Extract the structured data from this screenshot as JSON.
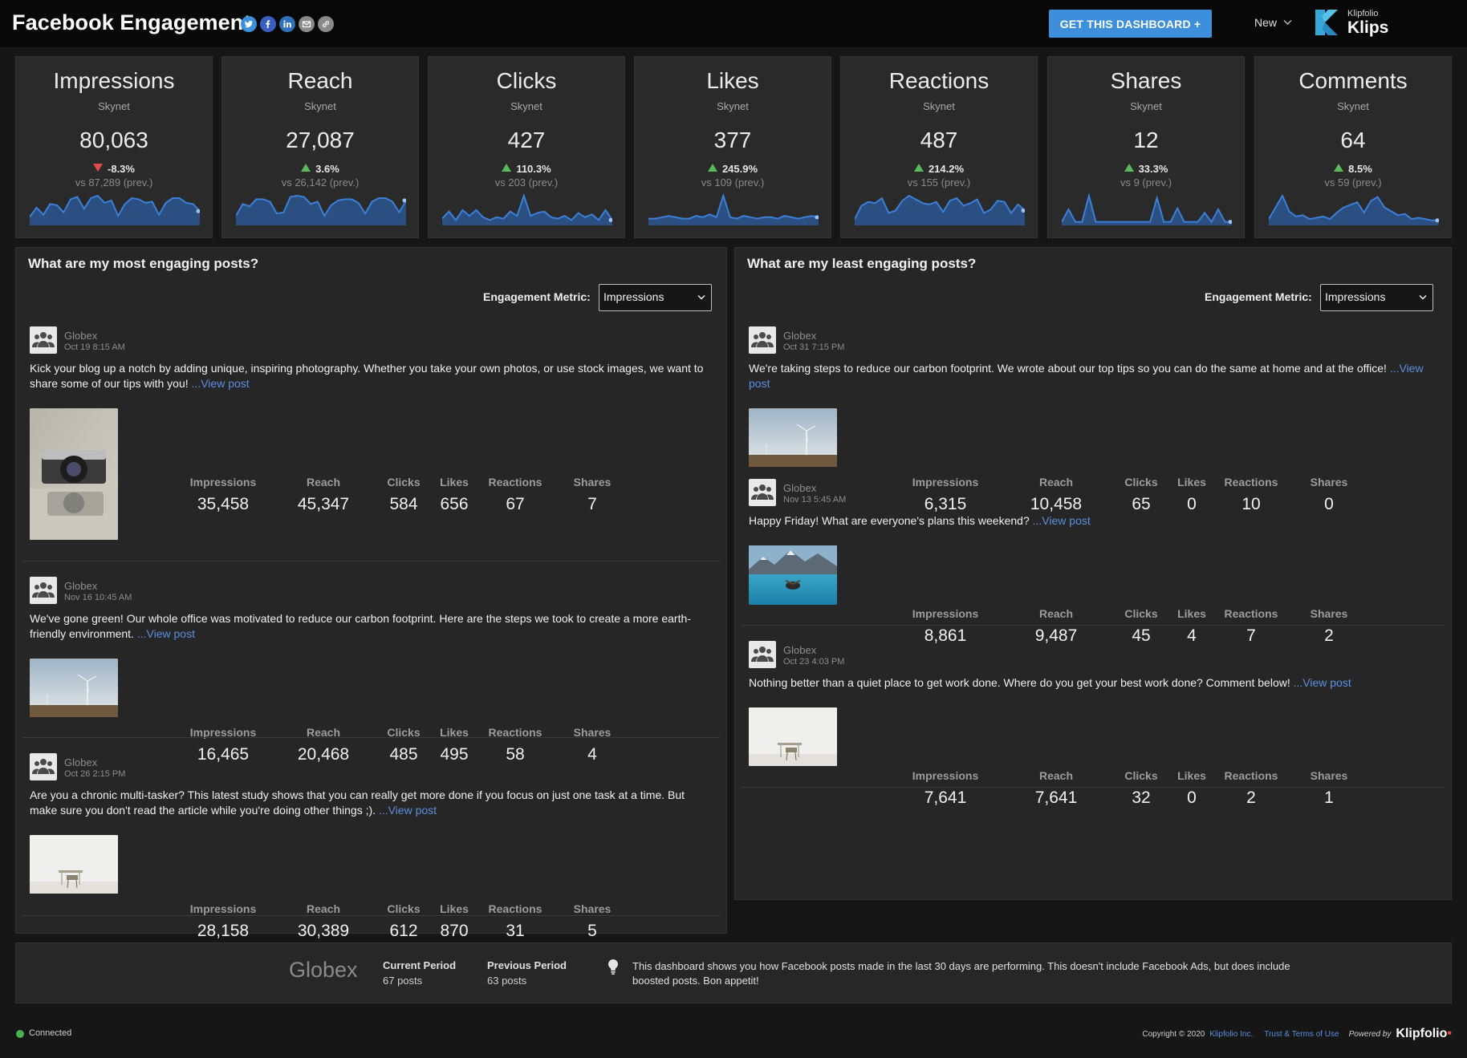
{
  "header": {
    "title": "Facebook Engagement",
    "share_icons": [
      "twitter-icon",
      "facebook-icon",
      "linkedin-icon",
      "email-icon",
      "link-icon"
    ],
    "get_dashboard_label": "GET THIS DASHBOARD +",
    "new_menu_label": "New",
    "brand_small": "Klipfolio",
    "brand_big": "Klips"
  },
  "kpis": [
    {
      "title": "Impressions",
      "source": "Skynet",
      "value": "80,063",
      "direction": "down",
      "change": "-8.3%",
      "prev": "vs 87,289 (prev.)",
      "spark": [
        5,
        13,
        7,
        16,
        15,
        9,
        20,
        22,
        12,
        21,
        23,
        17,
        19,
        6,
        16,
        21,
        20,
        17,
        18,
        7,
        17,
        21,
        21,
        17,
        16,
        10
      ]
    },
    {
      "title": "Reach",
      "source": "Skynet",
      "value": "27,087",
      "direction": "up",
      "change": "3.6%",
      "prev": "vs 26,142 (prev.)",
      "spark": [
        6,
        16,
        14,
        20,
        20,
        18,
        8,
        9,
        22,
        23,
        22,
        16,
        18,
        6,
        15,
        19,
        20,
        20,
        17,
        8,
        18,
        21,
        21,
        18,
        9,
        19
      ]
    },
    {
      "title": "Clicks",
      "source": "Skynet",
      "value": "427",
      "direction": "up",
      "change": "110.3%",
      "prev": "vs 203 (prev.)",
      "spark": [
        3,
        8,
        2,
        9,
        5,
        9,
        4,
        2,
        4,
        3,
        8,
        5,
        19,
        5,
        7,
        8,
        4,
        3,
        5,
        2,
        7,
        4,
        6,
        2,
        9,
        2
      ]
    },
    {
      "title": "Likes",
      "source": "Skynet",
      "value": "377",
      "direction": "up",
      "change": "245.9%",
      "prev": "vs 109 (prev.)",
      "spark": [
        3,
        3,
        4,
        5,
        4,
        3,
        3,
        5,
        4,
        6,
        4,
        19,
        4,
        3,
        5,
        4,
        3,
        4,
        4,
        3,
        5,
        4,
        3,
        4,
        5,
        4
      ]
    },
    {
      "title": "Reactions",
      "source": "Skynet",
      "value": "487",
      "direction": "up",
      "change": "214.2%",
      "prev": "vs 155 (prev.)",
      "spark": [
        3,
        14,
        17,
        16,
        20,
        8,
        10,
        18,
        22,
        19,
        16,
        15,
        17,
        9,
        18,
        20,
        14,
        16,
        19,
        8,
        11,
        18,
        17,
        8,
        15,
        10
      ]
    },
    {
      "title": "Shares",
      "source": "Skynet",
      "value": "12",
      "direction": "up",
      "change": "33.3%",
      "prev": "vs 9 (prev.)",
      "spark": [
        1,
        12,
        1,
        1,
        24,
        1,
        1,
        1,
        1,
        1,
        1,
        1,
        1,
        1,
        22,
        1,
        1,
        13,
        1,
        1,
        1,
        9,
        1,
        12,
        1,
        1
      ]
    },
    {
      "title": "Comments",
      "source": "Skynet",
      "value": "64",
      "direction": "up",
      "change": "8.5%",
      "prev": "vs 59 (prev.)",
      "spark": [
        3,
        12,
        21,
        9,
        5,
        6,
        3,
        4,
        5,
        3,
        8,
        12,
        14,
        16,
        8,
        17,
        20,
        12,
        9,
        6,
        7,
        3,
        4,
        3,
        2,
        2
      ]
    }
  ],
  "most_engaging": {
    "title": "What are my most engaging posts?",
    "metric_label": "Engagement Metric:",
    "metric_value": "Impressions",
    "posts": [
      {
        "author": "Globex",
        "date": "Oct 19 8:15 AM",
        "text": "Kick your blog up a notch by adding unique, inspiring photography. Whether you take your own photos, or use stock images, we want to share some of our tips with you!",
        "link": "...View post",
        "image": "camera-photo",
        "stats": {
          "Impressions": "35,458",
          "Reach": "45,347",
          "Clicks": "584",
          "Likes": "656",
          "Reactions": "67",
          "Shares": "7"
        }
      },
      {
        "author": "Globex",
        "date": "Nov 16 10:45 AM",
        "text": "We've gone green! Our whole office was motivated to reduce our carbon footprint. Here are the steps we took to create a more earth-friendly environment.",
        "link": "...View post",
        "image": "wind-turbine-photo",
        "stats": {
          "Impressions": "16,465",
          "Reach": "20,468",
          "Clicks": "485",
          "Likes": "495",
          "Reactions": "58",
          "Shares": "4"
        }
      },
      {
        "author": "Globex",
        "date": "Oct 26 2:15 PM",
        "text": "Are you a chronic multi-tasker? This latest study shows that you can really get more done if you focus on just one task at a time. But make sure you don't read the article while you're doing other things ;).",
        "link": "...View post",
        "image": "desk-chair-photo",
        "stats": {
          "Impressions": "28,158",
          "Reach": "30,389",
          "Clicks": "612",
          "Likes": "870",
          "Reactions": "31",
          "Shares": "5"
        }
      }
    ]
  },
  "least_engaging": {
    "title": "What are my least engaging posts?",
    "metric_label": "Engagement Metric:",
    "metric_value": "Impressions",
    "posts": [
      {
        "author": "Globex",
        "date": "Oct 31 7:15 PM",
        "text": "We're taking steps to reduce our carbon footprint. We wrote about our top tips so you can do the same at home and at the office!",
        "link": "...View post",
        "image": "wind-turbine-photo",
        "stats": {
          "Impressions": "6,315",
          "Reach": "10,458",
          "Clicks": "65",
          "Likes": "0",
          "Reactions": "10",
          "Shares": "0"
        }
      },
      {
        "author": "Globex",
        "date": "Nov 13 5:45 AM",
        "text": "Happy Friday! What are everyone's plans this weekend?",
        "link": "...View post",
        "image": "mountain-lake-photo",
        "stats": {
          "Impressions": "8,861",
          "Reach": "9,487",
          "Clicks": "45",
          "Likes": "4",
          "Reactions": "7",
          "Shares": "2"
        }
      },
      {
        "author": "Globex",
        "date": "Oct 23 4:03 PM",
        "text": "Nothing better than a quiet place to get work done. Where do you get your best work done? Comment below!",
        "link": "...View post",
        "image": "desk-chair-photo",
        "stats": {
          "Impressions": "7,641",
          "Reach": "7,641",
          "Clicks": "32",
          "Likes": "0",
          "Reactions": "2",
          "Shares": "1"
        }
      }
    ]
  },
  "stat_labels": [
    "Impressions",
    "Reach",
    "Clicks",
    "Likes",
    "Reactions",
    "Shares"
  ],
  "footer": {
    "brand": "Globex",
    "current_label": "Current Period",
    "current_value": "67 posts",
    "previous_label": "Previous Period",
    "previous_value": "63 posts",
    "note": "This dashboard shows you how Facebook posts made in the last 30 days are performing. This doesn't include Facebook Ads, but does include boosted posts. Bon appetit!"
  },
  "status": {
    "connection": "Connected",
    "copyright": "Copyright © 2020",
    "company_link": "Klipfolio Inc.",
    "terms_link": "Trust & Terms of Use",
    "powered_by": "Powered by",
    "powered_brand": "Klipfolio"
  },
  "colors": {
    "accent": "#3d8fdc",
    "spark_line": "#3b7fd8",
    "spark_fill": "#2a4f80",
    "up": "#5cb85c",
    "down": "#e34a4a",
    "link": "#5b8fe0"
  }
}
